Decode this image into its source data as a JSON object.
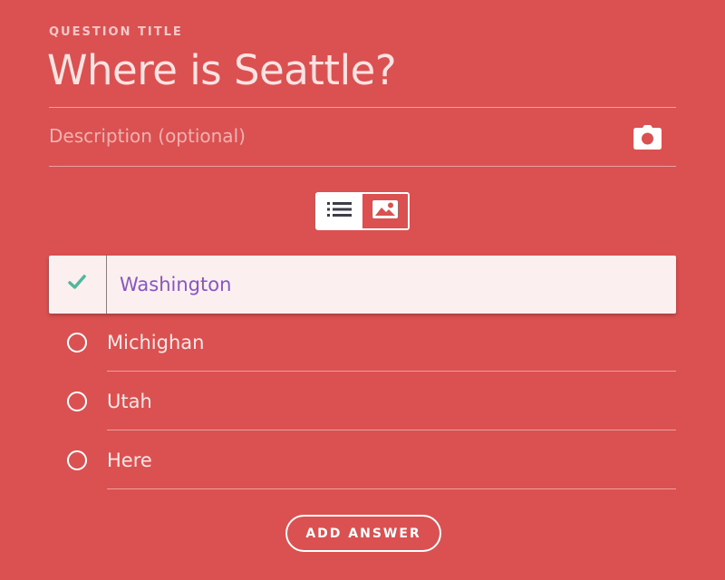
{
  "question": {
    "section_label": "QUESTION TITLE",
    "title": "Where is Seattle?",
    "description_placeholder": "Description (optional)"
  },
  "icons": {
    "camera": "camera-icon",
    "list_view": "list-icon",
    "image_view": "image-icon",
    "correct": "check-icon",
    "unselected": "radio-circle-icon"
  },
  "view_toggle": {
    "active": "list"
  },
  "answers": [
    {
      "label": "Washington",
      "correct": true
    },
    {
      "label": "Michighan",
      "correct": false
    },
    {
      "label": "Utah",
      "correct": false
    },
    {
      "label": "Here",
      "correct": false
    }
  ],
  "add_answer_label": "ADD ANSWER",
  "colors": {
    "background": "#db5151",
    "selected_row": "#fcefef",
    "selected_text": "#8656c9",
    "check": "#4fb89a",
    "toggle_icon_dark": "#3d3d4a"
  }
}
